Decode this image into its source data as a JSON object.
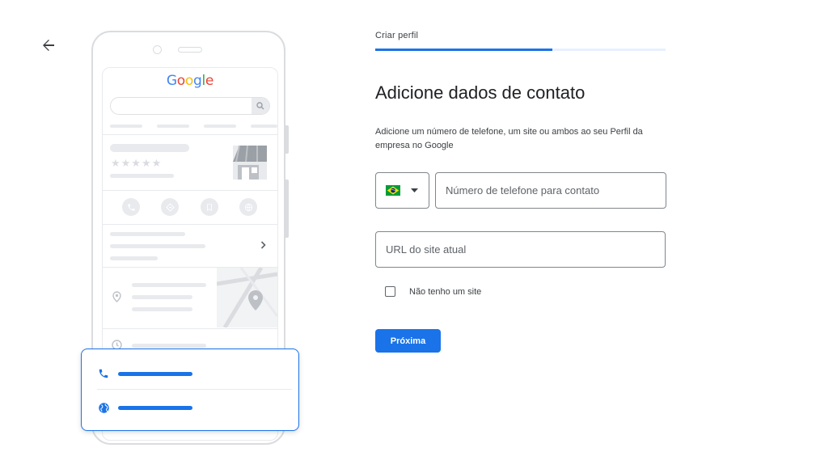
{
  "colors": {
    "accent": "#1a73e8",
    "progress_track": "#e8f0fe",
    "illustration_gray": "#e8eaed"
  },
  "nav": {
    "back_icon": "arrow-left-icon"
  },
  "illustration": {
    "google_logo": [
      "G",
      "o",
      "o",
      "g",
      "l",
      "e"
    ],
    "icons": [
      "phone-icon",
      "directions-icon",
      "bookmark-icon",
      "globe-icon",
      "chevron-right-icon",
      "location-pin-icon",
      "clock-icon",
      "map-pin-icon"
    ],
    "popup_icons": [
      "phone-icon",
      "globe-icon"
    ]
  },
  "form": {
    "step_label": "Criar perfil",
    "progress_fraction": 0.61,
    "title": "Adicione dados de contato",
    "description": "Adicione um número de telefone, um site ou ambos ao seu Perfil da empresa no Google",
    "country_flag_icon": "brazil-flag-icon",
    "phone_placeholder": "Número de telefone para contato",
    "url_placeholder": "URL do site atual",
    "no_site_label": "Não tenho um site",
    "no_site_checked": false,
    "next_label": "Próxima"
  }
}
